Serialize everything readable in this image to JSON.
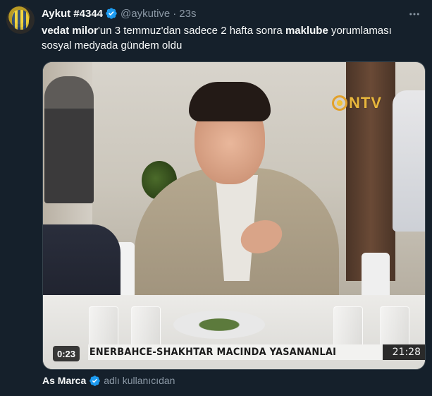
{
  "tweet": {
    "author": {
      "display_name": "Aykut #4344",
      "handle": "@aykutive",
      "separator": "·",
      "time": "23s"
    },
    "text": {
      "part1_bold": "vedat milor",
      "part2": "'un 3 temmuz'dan sadece 2 hafta sonra ",
      "part3_bold": "maklube",
      "part4": " yorumlaması sosyal medyada gündem oldu"
    },
    "media": {
      "channel_logo": "NTV",
      "ticker_text": "ENERBAHCE-SHAKHTAR MACINDA YASANANLAI",
      "ticker_time": "21:28",
      "duration": "0:23"
    },
    "attribution": {
      "source_name": "As Marca",
      "suffix": "adlı kullanıcıdan"
    },
    "icons": {
      "verified": "verified-badge-icon",
      "more": "more-options-icon"
    },
    "colors": {
      "background": "#15202b",
      "verified": "#1d9bf0",
      "secondary_text": "#8b98a5"
    }
  }
}
